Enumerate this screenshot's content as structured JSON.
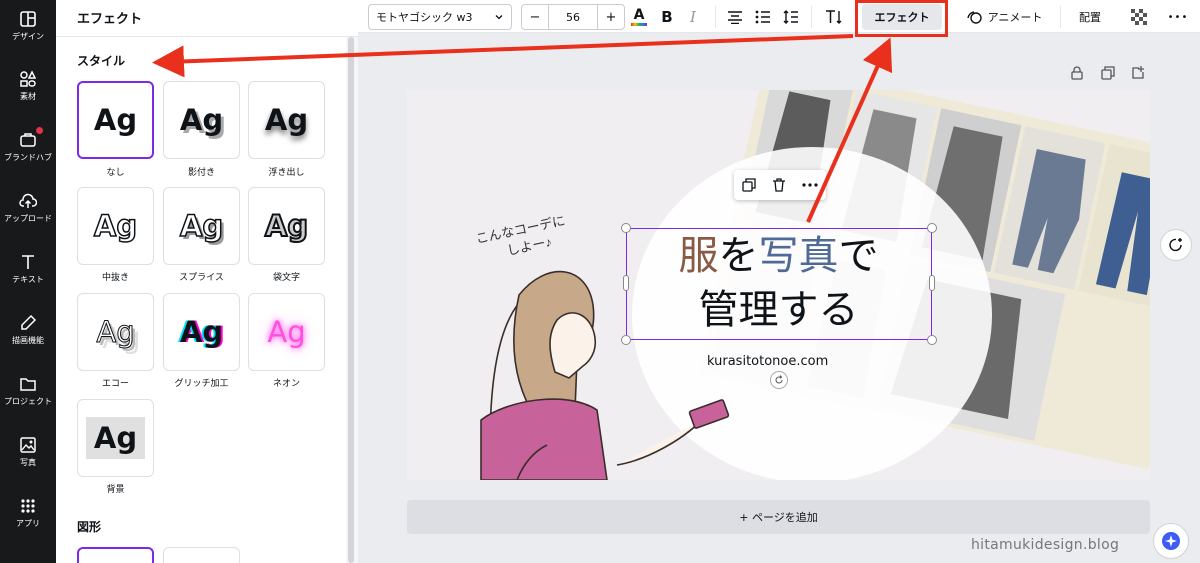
{
  "rail": {
    "items": [
      {
        "label": "デザイン",
        "icon": "layout-icon"
      },
      {
        "label": "素材",
        "icon": "shapes-icon"
      },
      {
        "label": "ブランドハブ",
        "icon": "brand-icon"
      },
      {
        "label": "アップロード",
        "icon": "upload-cloud-icon"
      },
      {
        "label": "テキスト",
        "icon": "text-t-icon"
      },
      {
        "label": "描画機能",
        "icon": "pen-icon"
      },
      {
        "label": "プロジェクト",
        "icon": "folder-icon"
      },
      {
        "label": "写真",
        "icon": "image-icon"
      },
      {
        "label": "アプリ",
        "icon": "apps-grid-icon"
      }
    ]
  },
  "panel": {
    "title": "エフェクト",
    "style_section": "スタイル",
    "shape_section": "図形",
    "styles": [
      {
        "sample": "Ag",
        "label": "なし",
        "selected": true
      },
      {
        "sample": "Ag",
        "label": "影付き"
      },
      {
        "sample": "Ag",
        "label": "浮き出し"
      },
      {
        "sample": "Ag",
        "label": "中抜き"
      },
      {
        "sample": "Ag",
        "label": "スプライス"
      },
      {
        "sample": "Ag",
        "label": "袋文字"
      },
      {
        "sample": "Ag",
        "label": "エコー"
      },
      {
        "sample": "Ag",
        "label": "グリッチ加工"
      },
      {
        "sample": "Ag",
        "label": "ネオン"
      },
      {
        "sample": "Ag",
        "label": "背景"
      }
    ]
  },
  "toolbar": {
    "font": "モトヤゴシック w3",
    "size_minus": "−",
    "size_value": "56",
    "size_plus": "+",
    "text_color_glyph": "A",
    "bold_glyph": "B",
    "italic_glyph": "I",
    "effect_label": "エフェクト",
    "animate_label": "アニメート",
    "position_label": "配置",
    "more_glyph": "•••",
    "accent_color": "#7d2ae8"
  },
  "canvas": {
    "speech": "こんなコーデに\nしよー♪",
    "headline_part1": "服",
    "headline_part2": "を",
    "headline_part3": "写真",
    "headline_part4": "で",
    "headline_line2": "管理する",
    "url": "kurasitotonoe.com",
    "add_page_label": "+ ページを追加",
    "colors": {
      "fuku": "#8a5a44",
      "shashin": "#4f6a96"
    }
  },
  "watermark": "hitamukidesign.blog",
  "annotation_color": "#e8301c"
}
